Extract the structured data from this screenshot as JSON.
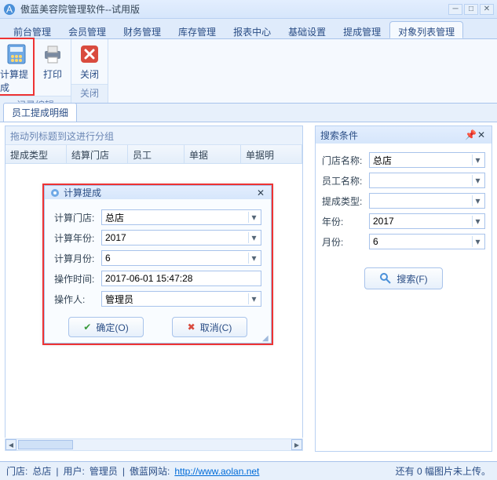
{
  "window": {
    "title": "傲蓝美容院管理软件--试用版"
  },
  "tabs": [
    "前台管理",
    "会员管理",
    "财务管理",
    "库存管理",
    "报表中心",
    "基础设置",
    "提成管理",
    "对象列表管理"
  ],
  "active_tab_index": 7,
  "ribbon": {
    "groups": [
      {
        "title": "记录编辑",
        "items": [
          {
            "label": "计算提成"
          },
          {
            "label": "打印"
          }
        ]
      },
      {
        "title": "关闭",
        "items": [
          {
            "label": "关闭"
          }
        ]
      }
    ]
  },
  "subtab": "员工提成明细",
  "grid": {
    "group_hint": "拖动列标题到这进行分组",
    "columns": [
      "提成类型",
      "结算门店",
      "员工",
      "单据",
      "单据明"
    ]
  },
  "search": {
    "title": "搜索条件",
    "rows": [
      {
        "label": "门店名称:",
        "value": "总店"
      },
      {
        "label": "员工名称:",
        "value": ""
      },
      {
        "label": "提成类型:",
        "value": ""
      },
      {
        "label": "年份:",
        "value": "2017"
      },
      {
        "label": "月份:",
        "value": "6"
      }
    ],
    "button": "搜索(F)"
  },
  "dialog": {
    "title": "计算提成",
    "rows": [
      {
        "label": "计算门店:",
        "value": "总店"
      },
      {
        "label": "计算年份:",
        "value": "2017"
      },
      {
        "label": "计算月份:",
        "value": "6"
      },
      {
        "label": "操作时间:",
        "value": "2017-06-01 15:47:28"
      },
      {
        "label": "操作人:",
        "value": "管理员"
      }
    ],
    "ok": "确定(O)",
    "cancel": "取消(C)"
  },
  "status": {
    "store_label": "门店:",
    "store_value": "总店",
    "user_label": "用户:",
    "user_value": "管理员",
    "site_label": "傲蓝网站:",
    "site_url": "http://www.aolan.net",
    "right": "还有 0 幅图片未上传。"
  }
}
